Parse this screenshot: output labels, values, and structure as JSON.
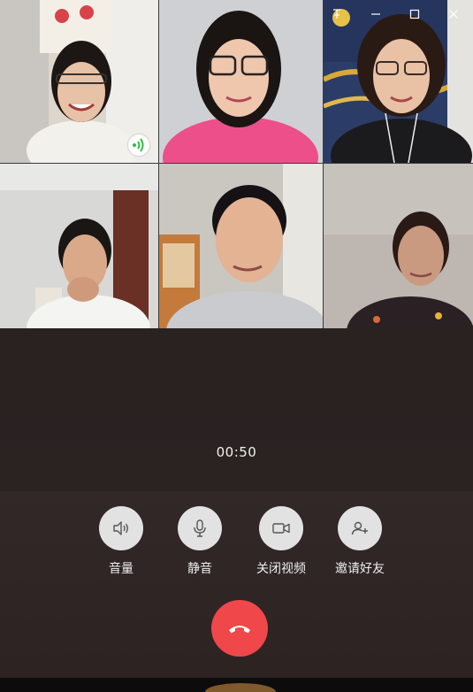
{
  "window": {
    "controls": [
      "pin-icon",
      "minimize-icon",
      "maximize-icon",
      "close-icon"
    ]
  },
  "participants": [
    {
      "position": "top-left",
      "speaking": true,
      "background": "#d9d4cc",
      "shirt": "#f2f0ec",
      "hair": "#1c1614"
    },
    {
      "position": "top-center",
      "speaking": false,
      "background": "#cfd0d4",
      "shirt": "#ec4f8a",
      "hair": "#1a1412"
    },
    {
      "position": "top-right",
      "speaking": false,
      "background": "#2b3c66",
      "shirt": "#1b1a1c",
      "hair": "#2a1a14"
    },
    {
      "position": "bottom-left",
      "speaking": false,
      "background": "#d8d8d6",
      "shirt": "#f4f4f2",
      "hair": "#1a1614"
    },
    {
      "position": "bottom-center",
      "speaking": false,
      "background": "#c9c7c0",
      "shirt": "#c9cbcf",
      "hair": "#141214"
    },
    {
      "position": "bottom-right",
      "speaking": false,
      "background": "#beb7b1",
      "shirt": "#2b2023",
      "hair": "#2a1a16"
    }
  ],
  "call": {
    "duration": "00:50"
  },
  "controls": {
    "volume_label": "音量",
    "mute_label": "静音",
    "camera_off_label": "关闭视频",
    "invite_label": "邀请好友"
  },
  "colors": {
    "hangup": "#f0474b",
    "control_bg": "#e2e2e2",
    "speaking_indicator": "#2fbf45"
  }
}
